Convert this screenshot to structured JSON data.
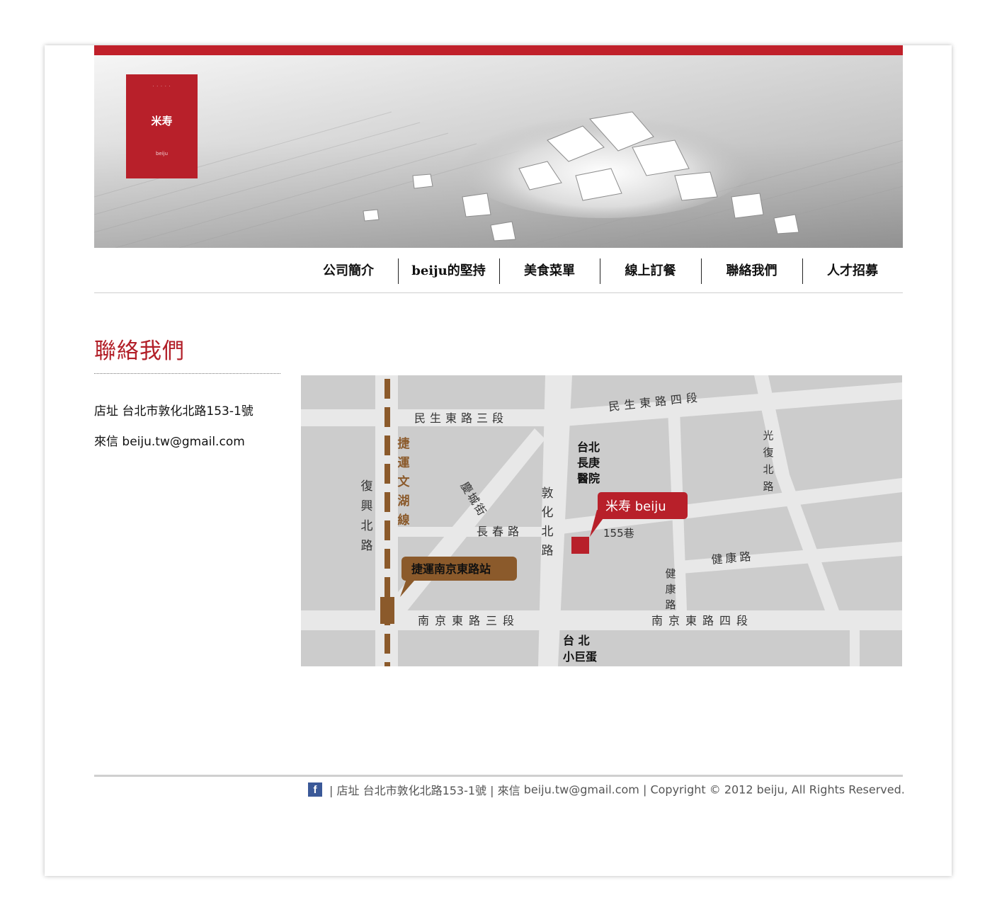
{
  "brand": {
    "logo_dots": "· · · · ·",
    "logo_name": "米寿",
    "logo_small": "beiju",
    "accent_color": "#c0202a"
  },
  "nav": {
    "items": [
      {
        "label": "公司簡介"
      },
      {
        "label": "beiju的堅持"
      },
      {
        "label": "美食菜單"
      },
      {
        "label": "線上訂餐"
      },
      {
        "label": "聯絡我們"
      },
      {
        "label": "人才招募"
      }
    ]
  },
  "contact": {
    "title": "聯絡我們",
    "address_line": "店址 台北市敦化北路153-1號",
    "email_line": "來信 beiju.tw@gmail.com"
  },
  "map": {
    "roads": {
      "minsheng3": "民生東路三段",
      "minsheng4": "民生東路四段",
      "guangfu": "光復北路",
      "fuxing": "復興北路",
      "qingcheng": "慶城街",
      "changchun": "長春路",
      "dunhua": "敦化北路",
      "lane": "155巷",
      "jiankang_h": "健康路",
      "jiankang_v": "健康路",
      "nanjing3": "南京東路三段",
      "nanjing4": "南京東路四段"
    },
    "mrt_line": "捷運文湖線",
    "mrt_station": "捷運南京東路站",
    "hospital": "台北長庚醫院",
    "arena_line1": "台 北",
    "arena_line2": "小巨蛋",
    "store_label": "米寿 beiju",
    "map_bg": "#cccccc",
    "road_color": "#e8e8e8",
    "mrt_color": "#8b5a2b"
  },
  "footer": {
    "facebook_icon": "facebook-icon",
    "address": "| 店址 台北市敦化北路153-1號 | 來信",
    "email": "beiju.tw@gmail.com",
    "copyright": "| Copyright © 2012 beiju, All Rights Reserved."
  }
}
